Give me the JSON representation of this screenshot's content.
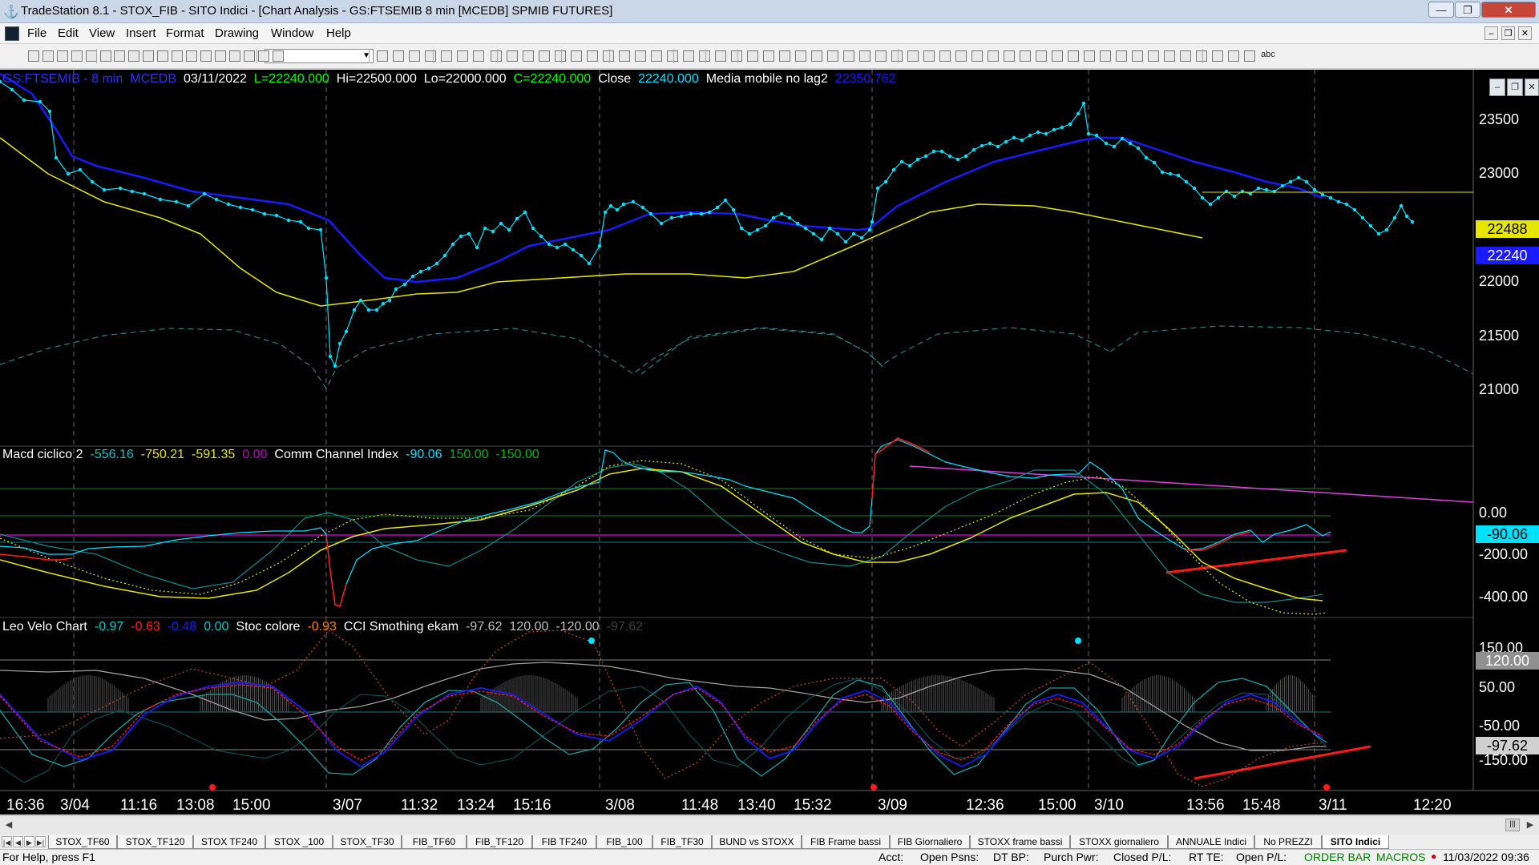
{
  "window": {
    "app_icon": "tradestation-logo-icon",
    "title": "TradeStation 8.1 - STOX_FIB - SITO Indici - [Chart Analysis - GS:FTSEMIB  8 min  [MCEDB] SPMIB FUTURES]",
    "controls": [
      "minimize-icon",
      "restore-icon",
      "close-icon"
    ]
  },
  "menu": [
    "File",
    "Edit",
    "View",
    "Insert",
    "Format",
    "Drawing",
    "Window",
    "Help"
  ],
  "toolbar": {
    "draw_text_tool": "abc"
  },
  "colors": {
    "price": "#00e0ff",
    "ma_blue": "#1a1aff",
    "ma_yellow": "#e6e600",
    "cycle": "#2f7f7f",
    "trend_red": "#ff1a1a",
    "trend_magenta": "#e040e0",
    "green": "#00b400",
    "cyan": "#00c8c8",
    "gray": "#a0a0a0"
  },
  "price_panel": {
    "header": [
      {
        "text": "GS:FTSEMIB - 8 min",
        "color": "#3030ff"
      },
      {
        "text": "MCEDB",
        "color": "#3030ff"
      },
      {
        "text": "03/11/2022",
        "color": "#ffffff"
      },
      {
        "text": "L=22240.000",
        "color": "#00ff00"
      },
      {
        "text": "Hi=22500.000",
        "color": "#ffffff"
      },
      {
        "text": "Lo=22000.000",
        "color": "#ffffff"
      },
      {
        "text": "C=22240.000",
        "color": "#00ff00"
      },
      {
        "text": "Close",
        "color": "#ffffff"
      },
      {
        "text": "22240.000",
        "color": "#00e0ff"
      },
      {
        "text": "Media mobile no lag2",
        "color": "#ffffff"
      },
      {
        "text": "22350.762",
        "color": "#1a1aff"
      }
    ],
    "axis_labels": [
      "23500",
      "23000",
      "22000",
      "21500",
      "21000"
    ],
    "tags": [
      {
        "text": "22488",
        "bg": "#e6e600",
        "color": "#000000"
      },
      {
        "text": "22240",
        "bg": "#1a1aff",
        "color": "#ffffff"
      }
    ]
  },
  "macd_panel": {
    "header": [
      {
        "text": "Macd ciclico 2",
        "color": "#ffffff"
      },
      {
        "text": "-556.16",
        "color": "#00c8c8"
      },
      {
        "text": "-750.21",
        "color": "#e6e600"
      },
      {
        "text": "-591.35",
        "color": "#e6e600"
      },
      {
        "text": "0.00",
        "color": "#c000c0"
      },
      {
        "text": "Comm Channel Index",
        "color": "#ffffff"
      },
      {
        "text": "-90.06",
        "color": "#00e0ff"
      },
      {
        "text": "150.00",
        "color": "#00b400"
      },
      {
        "text": "-150.00",
        "color": "#00b400"
      }
    ],
    "axis_labels": [
      "0.00",
      "-200.00",
      "-400.00"
    ],
    "tags": [
      {
        "text": "-90.06",
        "bg": "#00e0ff",
        "color": "#000000"
      }
    ]
  },
  "leo_panel": {
    "header": [
      {
        "text": "Leo Velo Chart",
        "color": "#ffffff"
      },
      {
        "text": "-0.97",
        "color": "#00c8c8"
      },
      {
        "text": "-0.63",
        "color": "#ff2020"
      },
      {
        "text": "-0.48",
        "color": "#1a1aff"
      },
      {
        "text": "0.00",
        "color": "#00c8c8"
      },
      {
        "text": "Stoc colore",
        "color": "#ffffff"
      },
      {
        "text": "-0.93",
        "color": "#ff8000"
      },
      {
        "text": "CCI Smothing ekam",
        "color": "#ffffff"
      },
      {
        "text": "-97.62",
        "color": "#c0c0c0"
      },
      {
        "text": "120.00",
        "color": "#c0c0c0"
      },
      {
        "text": "-120.00",
        "color": "#c0c0c0"
      },
      {
        "text": "-97.62",
        "color": "#404040"
      }
    ],
    "axis_labels": [
      "150.00",
      "50.00",
      "-50.00",
      "-150.00"
    ],
    "tags": [
      {
        "text": "120.00",
        "bg": "#909090",
        "color": "#ffffff"
      },
      {
        "text": "-97.62",
        "bg": "#d0d0d0",
        "color": "#000000"
      }
    ]
  },
  "x_axis": [
    "16:36",
    "3/04",
    "11:16",
    "13:08",
    "15:00",
    "3/07",
    "11:32",
    "13:24",
    "15:16",
    "3/08",
    "11:48",
    "13:40",
    "15:32",
    "3/09",
    "12:36",
    "15:00",
    "3/10",
    "13:56",
    "15:48",
    "3/11",
    "12:20"
  ],
  "tabs": [
    "STOX_TF60",
    "STOX_TF120",
    "STOX TF240",
    "STOX _100",
    "STOX_TF30",
    "FIB_TF60",
    "FIB_TF120",
    "FIB TF240",
    "FIB_100",
    "FIB_TF30",
    "BUND vs STOXX",
    "FIB Frame bassi",
    "FIB Giornaliero",
    "STOXX frame bassi",
    "STOXX giornaliero",
    "ANNUALE Indici",
    "No PREZZI",
    "SITO Indici"
  ],
  "active_tab": "SITO Indici",
  "status": {
    "help": "For Help, press F1",
    "acct": "Acct:",
    "open_psns": "Open Psns:",
    "dt_bp": "DT BP:",
    "purch_pwr": "Purch Pwr:",
    "closed_pl": "Closed P/L:",
    "rt_te": "RT TE:",
    "open_pl": "Open P/L:",
    "order_bar": "ORDER BAR",
    "macros": "MACROS",
    "datetime": "11/03/2022 09:36"
  }
}
